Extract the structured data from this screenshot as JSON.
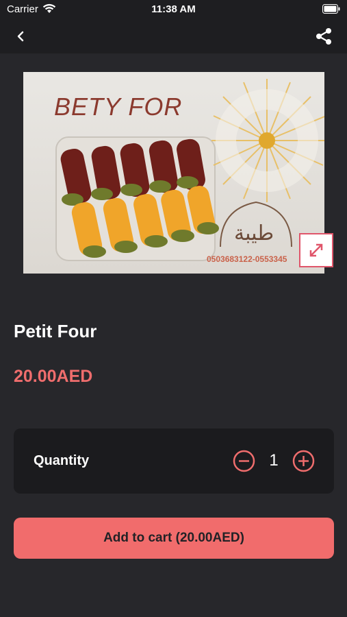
{
  "status_bar": {
    "carrier": "Carrier",
    "time": "11:38 AM",
    "icons": [
      "wifi-icon",
      "battery-icon"
    ]
  },
  "nav": {
    "back_icon": "chevron-left-icon",
    "share_icon": "share-icon"
  },
  "product": {
    "image_text": "BETY FOR",
    "image_phone": "0503683122-0553345",
    "expand_icon": "expand-icon",
    "name": "Petit Four",
    "price": "20.00AED"
  },
  "quantity": {
    "label": "Quantity",
    "value": "1",
    "minus_icon": "minus-circle-icon",
    "plus_icon": "plus-circle-icon"
  },
  "cart": {
    "button_label": "Add to cart (20.00AED)"
  },
  "colors": {
    "accent": "#ef6d6d",
    "background": "#27272b",
    "card": "#1b1b1e"
  }
}
